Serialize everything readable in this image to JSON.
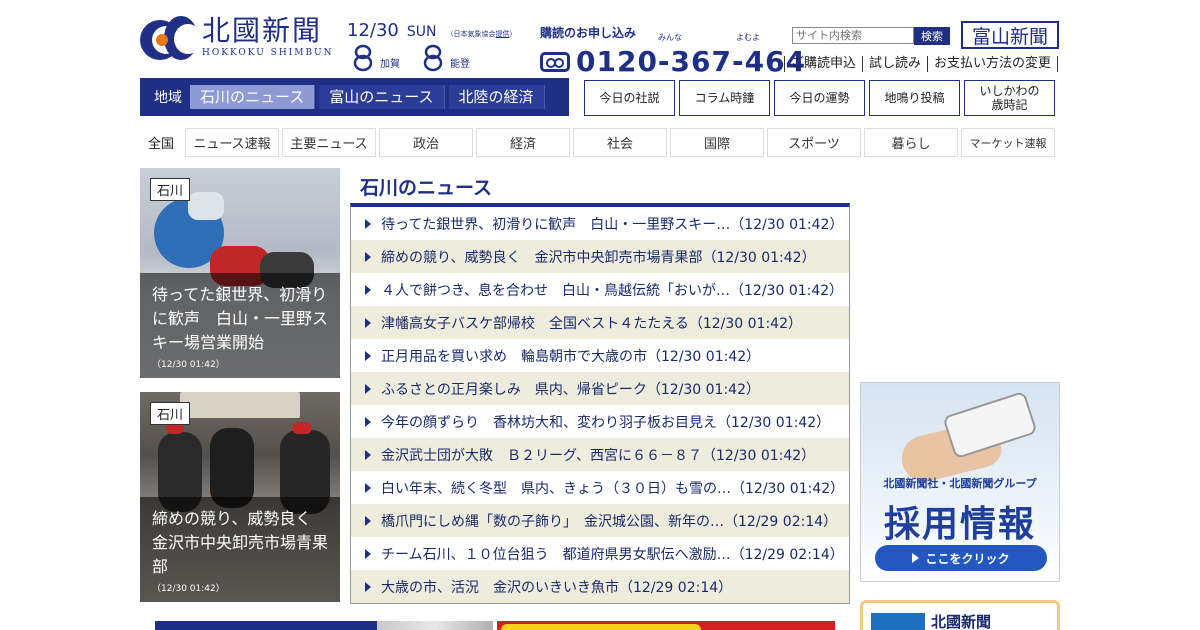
{
  "header": {
    "logo_jp": "北國新聞",
    "logo_en": "HOKKOKU SHIMBUN",
    "date": "12/30",
    "weekday": "SUN",
    "weather_source_prefix": "（日本気象協会",
    "weather_source_link": "提供",
    "weather_source_suffix": "）",
    "weather": [
      {
        "icon": "cloud-snow-icon",
        "area": "加賀"
      },
      {
        "icon": "cloud-snow-icon",
        "area": "能登"
      }
    ],
    "subscribe_label": "購読のお申し込み",
    "subscribe_ruby_1": "みんな",
    "subscribe_ruby_2": "よむよ",
    "phone": "0120-367-464",
    "search_placeholder": "サイト内検索",
    "search_button": "検索",
    "toyama_logo": "富山新聞",
    "links": [
      "ご購読申込",
      "試し読み",
      "お支払い方法の変更"
    ]
  },
  "region_nav": {
    "label": "地域",
    "tabs": [
      "石川のニュース",
      "富山のニュース",
      "北陸の経済"
    ],
    "active_index": 0
  },
  "column_buttons": [
    "今日の社説",
    "コラム時鐘",
    "今日の運勢",
    "地鳴り投稿",
    "いしかわの歳時記"
  ],
  "category_nav": {
    "all": "全国",
    "items": [
      "ニュース速報",
      "主要ニュース",
      "政治",
      "経済",
      "社会",
      "国際",
      "スポーツ",
      "暮らし",
      "マーケット速報"
    ]
  },
  "photos": [
    {
      "tag": "石川",
      "caption": "待ってた銀世界、初滑りに歓声　白山・一里野スキー場営業開始",
      "time": "（12/30 01:42）"
    },
    {
      "tag": "石川",
      "caption": "締めの競り、威勢良く　金沢市中央卸売市場青果部",
      "time": "（12/30 01:42）"
    }
  ],
  "news": {
    "title": "石川のニュース",
    "items": [
      "待ってた銀世界、初滑りに歓声　白山・一里野スキー…（12/30 01:42）",
      "締めの競り、威勢良く　金沢市中央卸売市場青果部（12/30 01:42）",
      "４人で餅つき、息を合わせ　白山・鳥越伝統「おいが…（12/30 01:42）",
      "津幡高女子バスケ部帰校　全国ベスト４たたえる（12/30 01:42）",
      "正月用品を買い求め　輪島朝市で大歳の市（12/30 01:42）",
      "ふるさとの正月楽しみ　県内、帰省ピーク（12/30 01:42）",
      "今年の顔ずらり　香林坊大和、変わり羽子板お目見え（12/30 01:42）",
      "金沢武士団が大敗　Ｂ２リーグ、西宮に６６－８７（12/30 01:42）",
      "白い年末、続く冬型　県内、きょう（３０日）も雪の…（12/30 01:42）",
      "橋爪門にしめ縄「数の子飾り」　金沢城公園、新年の…（12/29 02:14）",
      "チーム石川、１０位台狙う　都道府県男女駅伝へ激励…（12/29 02:14）",
      "大歳の市、活況　金沢のいきいき魚市（12/29 02:14）"
    ]
  },
  "recruit_banner": {
    "company": "北國新聞社・北國新聞グループ",
    "title": "採用情報",
    "button": "ここをクリック"
  },
  "paper_banner": {
    "text": "北國新聞"
  },
  "colors": {
    "brand_navy": "#1f2f86",
    "active_tab": "#8e9ad4",
    "row_stripe": "#eeecdc",
    "recruit_blue": "#2458c0"
  }
}
